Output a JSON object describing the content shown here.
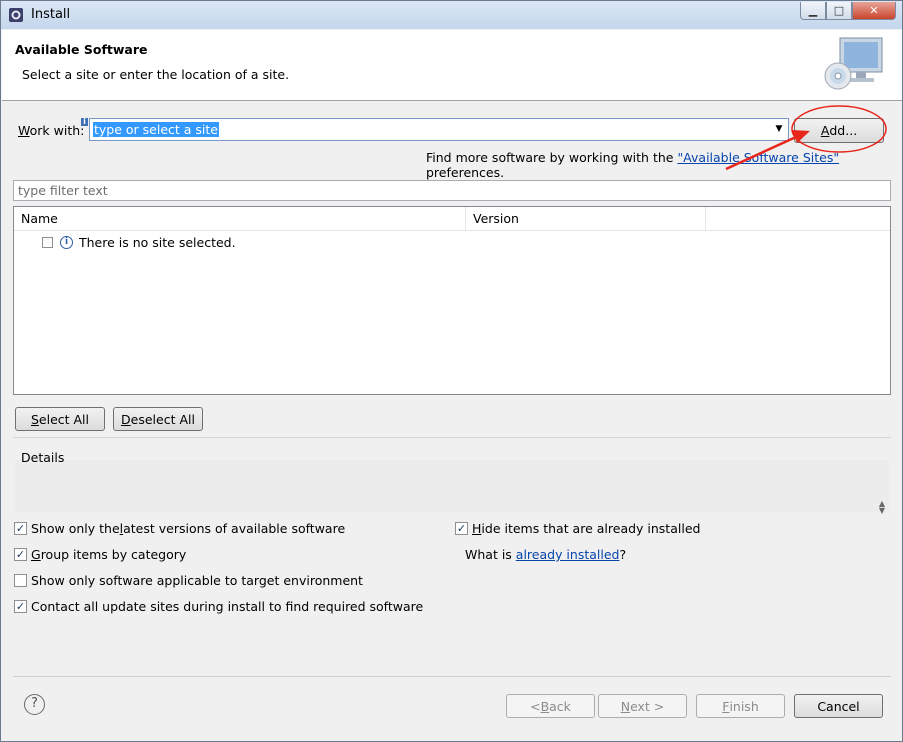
{
  "window": {
    "title": "Install",
    "controls": {
      "minimize": "▁",
      "maximize": "□",
      "close": "✕"
    }
  },
  "banner": {
    "title": "Available Software",
    "description": "Select a site or enter the location of a site."
  },
  "work_with": {
    "label_mnemonic": "W",
    "label_rest": "ork with:",
    "value": "type or select a site",
    "add_button_mnemonic": "A",
    "add_button_rest": "dd..."
  },
  "find_more": {
    "prefix": "Find more software by working with the ",
    "link": "\"Available Software Sites\"",
    "suffix": " preferences."
  },
  "filter": {
    "placeholder": "type filter text"
  },
  "table": {
    "columns": [
      "Name",
      "Version"
    ],
    "rows": [
      {
        "name": "There is no site selected.",
        "checked": false
      }
    ]
  },
  "selection_buttons": {
    "select_all_mnemonic": "S",
    "select_all_rest": "elect All",
    "deselect_all_mnemonic": "D",
    "deselect_all_rest": "eselect All"
  },
  "details": {
    "label": "Details"
  },
  "options": {
    "latest": {
      "before": "Show only the ",
      "mnemonic": "l",
      "after": "atest versions of available software",
      "checked": true
    },
    "group": {
      "before": "",
      "mnemonic": "G",
      "after": "roup items by category",
      "checked": true
    },
    "target": {
      "before": "Show only software applicable to target environment",
      "mnemonic": "",
      "after": "",
      "checked": false
    },
    "contact": {
      "before": "Contact all update sites during install to find required software",
      "mnemonic": "",
      "after": "",
      "checked": true
    },
    "hide": {
      "before": "",
      "mnemonic": "H",
      "after": "ide items that are already installed",
      "checked": true
    }
  },
  "already_installed": {
    "prefix": "What is ",
    "link": "already installed",
    "suffix": "?"
  },
  "footer": {
    "help": "?",
    "back": {
      "before": "< ",
      "mnemonic": "B",
      "after": "ack"
    },
    "next": {
      "before": "",
      "mnemonic": "N",
      "after": "ext >"
    },
    "finish": {
      "before": "",
      "mnemonic": "F",
      "after": "inish"
    },
    "cancel": "Cancel"
  },
  "colors": {
    "annotation": "#e8261b",
    "link": "#0645ad",
    "selection": "#3399ff"
  }
}
